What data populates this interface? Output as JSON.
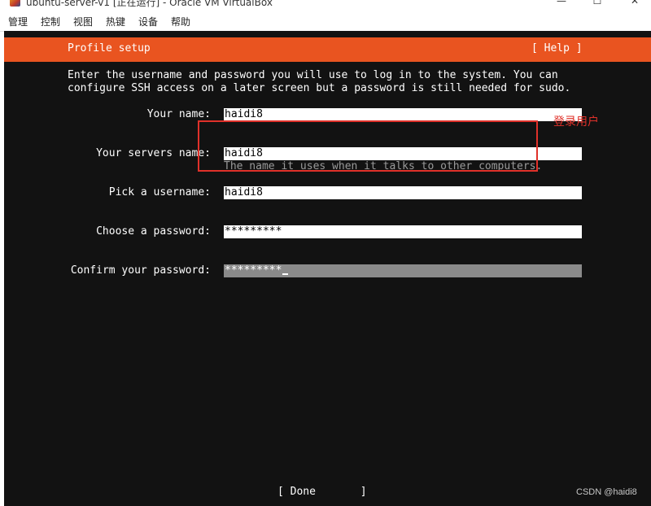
{
  "window": {
    "title": "ubuntu-server-v1 [正在运行] - Oracle VM VirtualBox",
    "minimize_glyph": "—",
    "maximize_glyph": "☐",
    "close_glyph": "✕"
  },
  "menubar": {
    "items": [
      {
        "label": "管理"
      },
      {
        "label": "控制"
      },
      {
        "label": "视图"
      },
      {
        "label": "热键"
      },
      {
        "label": "设备"
      },
      {
        "label": "帮助"
      }
    ]
  },
  "installer": {
    "header": {
      "title": "Profile setup",
      "help_label": "[ Help ]"
    },
    "intro_line1": "Enter the username and password you will use to log in to the system. You can",
    "intro_line2": "configure SSH access on a later screen but a password is still needed for sudo.",
    "fields": {
      "your_name": {
        "label": "Your name:",
        "value": "haidi8"
      },
      "server_name": {
        "label": "Your servers name:",
        "value": "haidi8",
        "hint": "The name it uses when it talks to other computers."
      },
      "username": {
        "label": "Pick a username:",
        "value": "haidi8"
      },
      "password": {
        "label": "Choose a password:",
        "value": "*********"
      },
      "confirm_password": {
        "label": "Confirm your password:",
        "value": "*********"
      }
    },
    "done_label": "[ Done       ]"
  },
  "annotation": {
    "text": "登录用户",
    "color": "#e0312a"
  },
  "watermark": "CSDN @haidi8",
  "colors": {
    "header": "#e95420",
    "background": "#121212",
    "focused_field": "#8a8a8a"
  }
}
